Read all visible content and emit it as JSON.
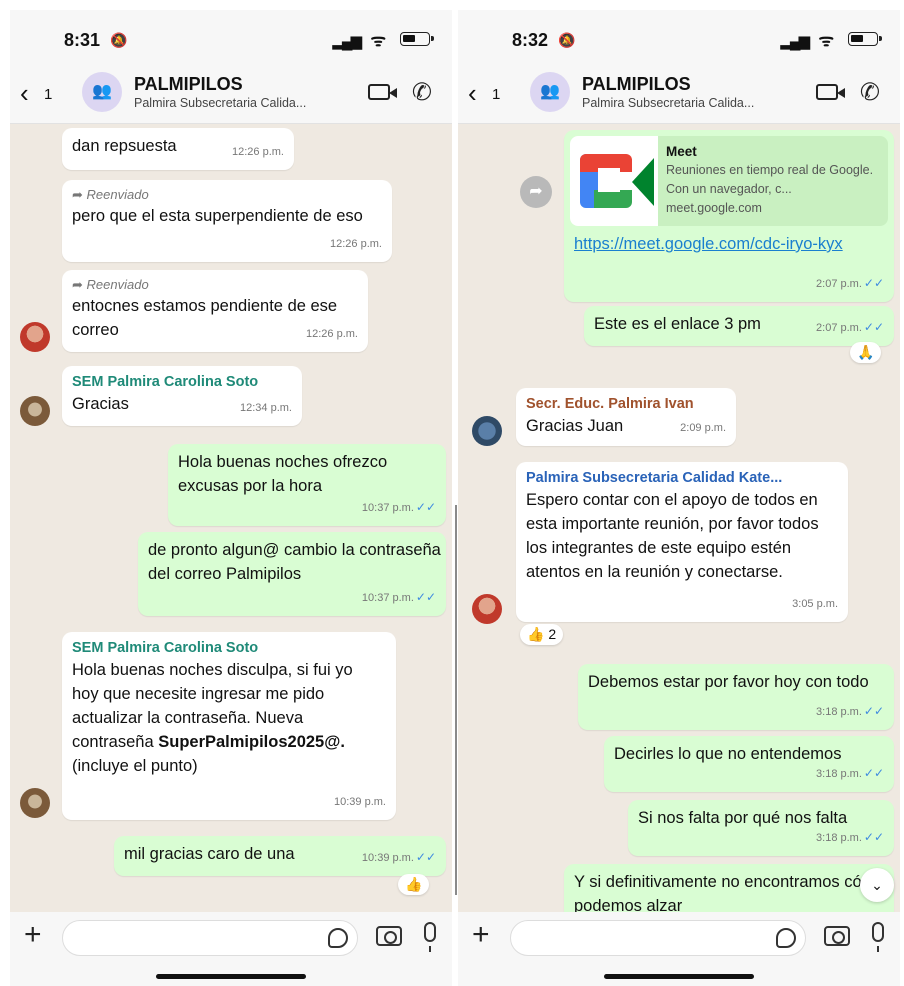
{
  "left": {
    "time": "8:31",
    "back_count": "1",
    "title": "PALMIPILOS",
    "subtitle": "Palmira Subsecretaria Calida...",
    "messages": [
      {
        "text": "dan repsuesta",
        "time": "12:26 p.m."
      },
      {
        "forwarded": "Reenviado",
        "text": "pero que el esta superpendiente de eso",
        "time": "12:26 p.m."
      },
      {
        "forwarded": "Reenviado",
        "text": "entocnes estamos pendiente de ese correo",
        "time": "12:26 p.m."
      },
      {
        "sender": "SEM Palmira Carolina Soto",
        "text": "Gracias",
        "time": "12:34 p.m."
      },
      {
        "text": "Hola buenas noches ofrezco excusas por la hora",
        "time": "10:37 p.m."
      },
      {
        "text": "de pronto algun@ cambio la contraseña del correo Palmipilos",
        "time": "10:37 p.m."
      },
      {
        "sender": "SEM Palmira Carolina Soto",
        "text_a": "Hola buenas noches disculpa, si fui yo hoy que necesite ingresar me pido actualizar la contraseña. Nueva contraseña",
        "text_bold": "SuperPalmipilos2025@.",
        "text_b": "(incluye el punto)",
        "time": "10:39 p.m."
      },
      {
        "text": "mil gracias caro de una",
        "time": "10:39 p.m."
      }
    ],
    "reaction": "👍"
  },
  "right": {
    "time": "8:32",
    "back_count": "1",
    "title": "PALMIPILOS",
    "subtitle": "Palmira Subsecretaria Calida...",
    "preview": {
      "title": "Meet",
      "desc": "Reuniones en tiempo real de Google. Con un navegador, c...",
      "domain": "meet.google.com"
    },
    "messages": [
      {
        "link": "https://meet.google.com/cdc-iryo-kyx",
        "time": "2:07 p.m."
      },
      {
        "text": "Este es el enlace 3 pm",
        "time": "2:07 p.m."
      },
      {
        "sender": "Secr. Educ. Palmira Ivan",
        "text": "Gracias Juan",
        "time": "2:09 p.m."
      },
      {
        "sender": "Palmira Subsecretaria Calidad Kate...",
        "text": "Espero contar con el apoyo de todos en esta importante reunión, por favor todos los integrantes de este equipo estén atentos en la reunión y conectarse.",
        "time": "3:05 p.m."
      },
      {
        "text": "Debemos estar por favor hoy con todo",
        "time": "3:18 p.m."
      },
      {
        "text": "Decirles lo que no entendemos",
        "time": "3:18 p.m."
      },
      {
        "text": "Si nos falta por qué nos falta",
        "time": "3:18 p.m."
      },
      {
        "text": "Y si definitivamente no encontramos cómo podemos alzar"
      }
    ],
    "pray_reaction": "🙏",
    "thumbs_reaction": "👍",
    "thumbs_count": "2"
  },
  "colors": {
    "outgoing_bubble": "#d9fdd3",
    "incoming_bubble": "#ffffff",
    "sender_teal": "#1f8a78",
    "sender_brown": "#a0522d",
    "sender_blue": "#2a63b8",
    "read_ticks": "#3f8ae0"
  },
  "icons": [
    "back-chevron-icon",
    "group-avatar-icon",
    "video-call-icon",
    "phone-call-icon",
    "plus-icon",
    "sticker-icon",
    "camera-icon",
    "mic-icon",
    "forward-icon",
    "chevron-down-icon"
  ]
}
